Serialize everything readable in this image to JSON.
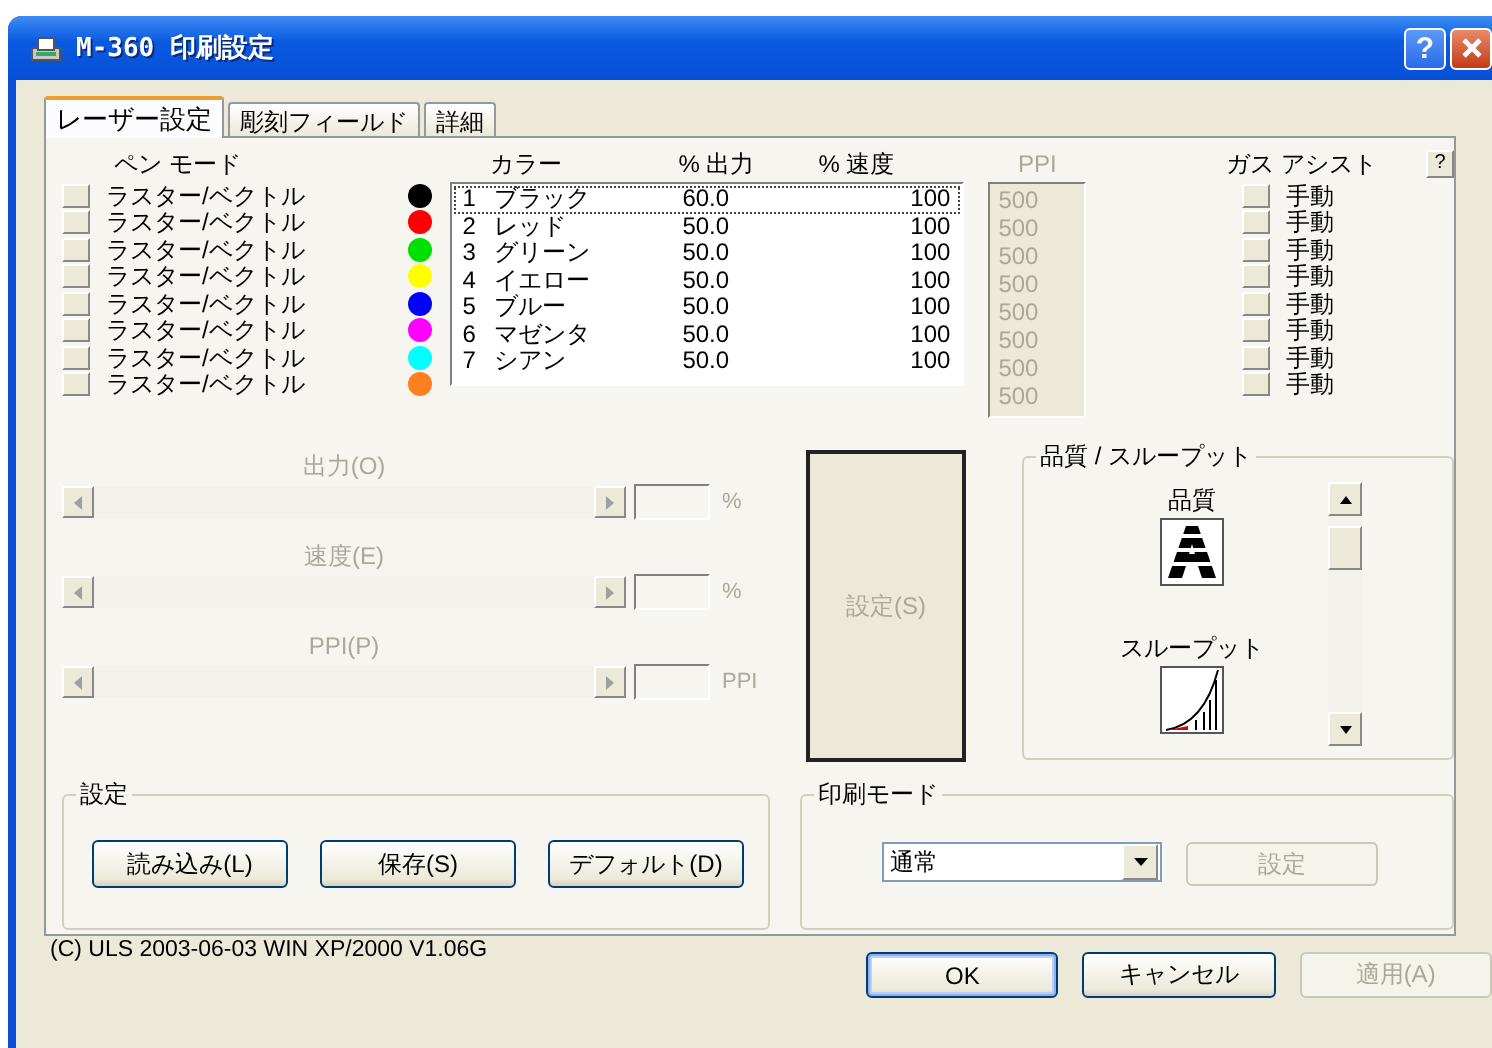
{
  "window": {
    "title": "M-360 印刷設定",
    "help_button": "?"
  },
  "tabs": [
    {
      "label": "レーザー設定",
      "selected": true
    },
    {
      "label": "彫刻フィールド",
      "selected": false
    },
    {
      "label": "詳細",
      "selected": false
    }
  ],
  "pen_mode": {
    "header": "ペン モード",
    "items": [
      "ラスター/ベクトル",
      "ラスター/ベクトル",
      "ラスター/ベクトル",
      "ラスター/ベクトル",
      "ラスター/ベクトル",
      "ラスター/ベクトル",
      "ラスター/ベクトル",
      "ラスター/ベクトル"
    ]
  },
  "pen_colors": [
    {
      "color": "#000000"
    },
    {
      "color": "#ff0000"
    },
    {
      "color": "#00e000"
    },
    {
      "color": "#ffff00"
    },
    {
      "color": "#0000ff"
    },
    {
      "color": "#ff00ff"
    },
    {
      "color": "#00ffff"
    },
    {
      "color": "#ff7f20"
    }
  ],
  "pen_list": {
    "columns": [
      "カラー",
      "% 出力",
      "% 速度"
    ],
    "rows": [
      {
        "number": "1",
        "name": "ブラック",
        "output": "60.0",
        "speed": "100",
        "focused": true
      },
      {
        "number": "2",
        "name": "レッド",
        "output": "50.0",
        "speed": "100",
        "focused": false
      },
      {
        "number": "3",
        "name": "グリーン",
        "output": "50.0",
        "speed": "100",
        "focused": false
      },
      {
        "number": "4",
        "name": "イエロー",
        "output": "50.0",
        "speed": "100",
        "focused": false
      },
      {
        "number": "5",
        "name": "ブルー",
        "output": "50.0",
        "speed": "100",
        "focused": false
      },
      {
        "number": "6",
        "name": "マゼンタ",
        "output": "50.0",
        "speed": "100",
        "focused": false
      },
      {
        "number": "7",
        "name": "シアン",
        "output": "50.0",
        "speed": "100",
        "focused": false
      }
    ]
  },
  "ppi": {
    "header": "PPI",
    "disabled": true,
    "values": [
      "500",
      "500",
      "500",
      "500",
      "500",
      "500",
      "500",
      "500"
    ]
  },
  "gas_assist": {
    "header": "ガス アシスト",
    "help_button": "?",
    "items": [
      "手動",
      "手動",
      "手動",
      "手動",
      "手動",
      "手動",
      "手動",
      "手動"
    ]
  },
  "sliders": [
    {
      "label": "出力(O)",
      "unit": "%",
      "disabled": true
    },
    {
      "label": "速度(E)",
      "unit": "%",
      "disabled": true
    },
    {
      "label": "PPI(P)",
      "unit": "PPI",
      "disabled": true
    }
  ],
  "set_button": {
    "label": "設定(S)",
    "disabled": true
  },
  "quality_group": {
    "title": "品質 / スループット",
    "quality_label": "品質",
    "throughput_label": "スループット"
  },
  "settings_group": {
    "title": "設定",
    "buttons": [
      {
        "label": "読み込み(L)"
      },
      {
        "label": "保存(S)"
      },
      {
        "label": "デフォルト(D)"
      }
    ]
  },
  "print_mode": {
    "title": "印刷モード",
    "value": "通常",
    "button": {
      "label": "設定",
      "disabled": true
    }
  },
  "copyright": "(C) ULS 2003-06-03 WIN XP/2000 V1.06G",
  "buttons": [
    {
      "label": "OK",
      "default": true,
      "disabled": false
    },
    {
      "label": "キャンセル",
      "default": false,
      "disabled": false
    },
    {
      "label": "適用(A)",
      "default": false,
      "disabled": true
    }
  ]
}
